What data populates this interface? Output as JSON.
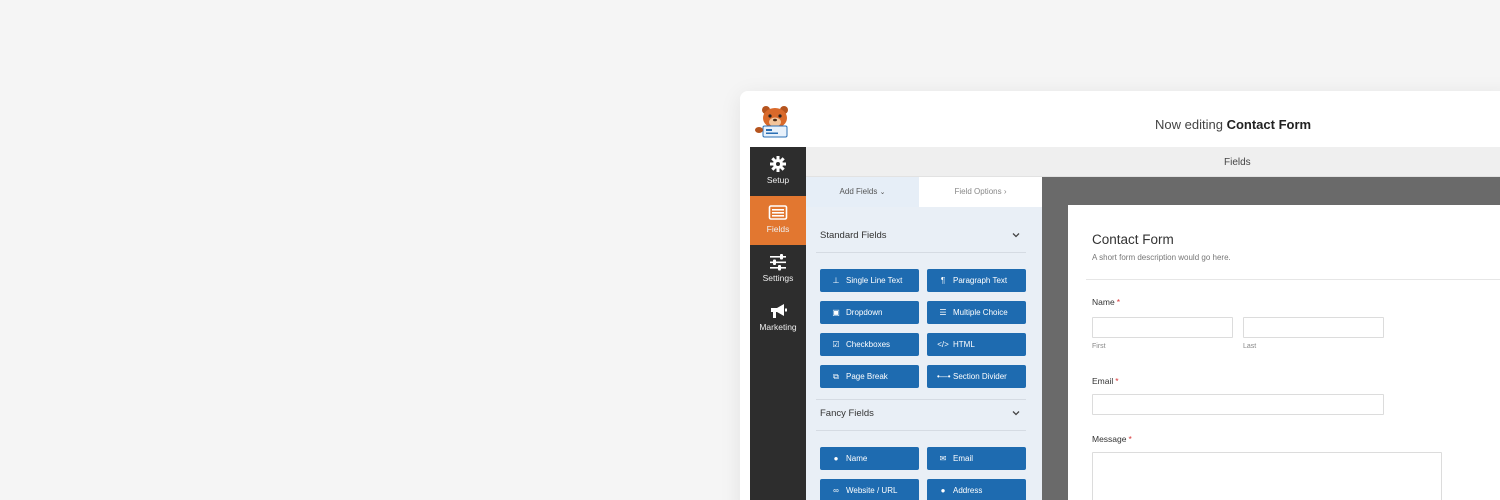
{
  "header": {
    "title_prefix": "Now editing",
    "title_form": "Contact Form"
  },
  "sidebar": {
    "items": [
      {
        "label": "Setup",
        "icon": "gear-icon"
      },
      {
        "label": "Fields",
        "icon": "fields-icon",
        "active": true
      },
      {
        "label": "Settings",
        "icon": "sliders-icon"
      },
      {
        "label": "Marketing",
        "icon": "megaphone-icon"
      }
    ]
  },
  "fields_header": "Fields",
  "panel": {
    "tabs": [
      {
        "label": "Add Fields",
        "icon": "chevron-down-icon"
      },
      {
        "label": "Field Options",
        "icon": "chevron-right-icon"
      }
    ],
    "standard_title": "Standard Fields",
    "standard_fields": [
      {
        "label": "Single Line Text",
        "icon": "text-cursor-icon"
      },
      {
        "label": "Paragraph Text",
        "icon": "paragraph-icon"
      },
      {
        "label": "Dropdown",
        "icon": "dropdown-icon"
      },
      {
        "label": "Multiple Choice",
        "icon": "list-icon"
      },
      {
        "label": "Checkboxes",
        "icon": "checkbox-icon"
      },
      {
        "label": "HTML",
        "icon": "code-icon"
      },
      {
        "label": "Page Break",
        "icon": "copy-icon"
      },
      {
        "label": "Section Divider",
        "icon": "divider-icon"
      }
    ],
    "fancy_title": "Fancy Fields",
    "fancy_fields": [
      {
        "label": "Name",
        "icon": "user-icon"
      },
      {
        "label": "Email",
        "icon": "envelope-icon"
      },
      {
        "label": "Website / URL",
        "icon": "link-icon"
      },
      {
        "label": "Address",
        "icon": "map-pin-icon"
      }
    ]
  },
  "form": {
    "title": "Contact Form",
    "description": "A short form description would go here.",
    "name_label": "Name",
    "first_label": "First",
    "last_label": "Last",
    "email_label": "Email",
    "message_label": "Message",
    "required_mark": "*"
  },
  "colors": {
    "accent_orange": "#e27730",
    "button_blue": "#1e6bb0",
    "sidebar_dark": "#2d2d2d",
    "required_red": "#d63638"
  }
}
